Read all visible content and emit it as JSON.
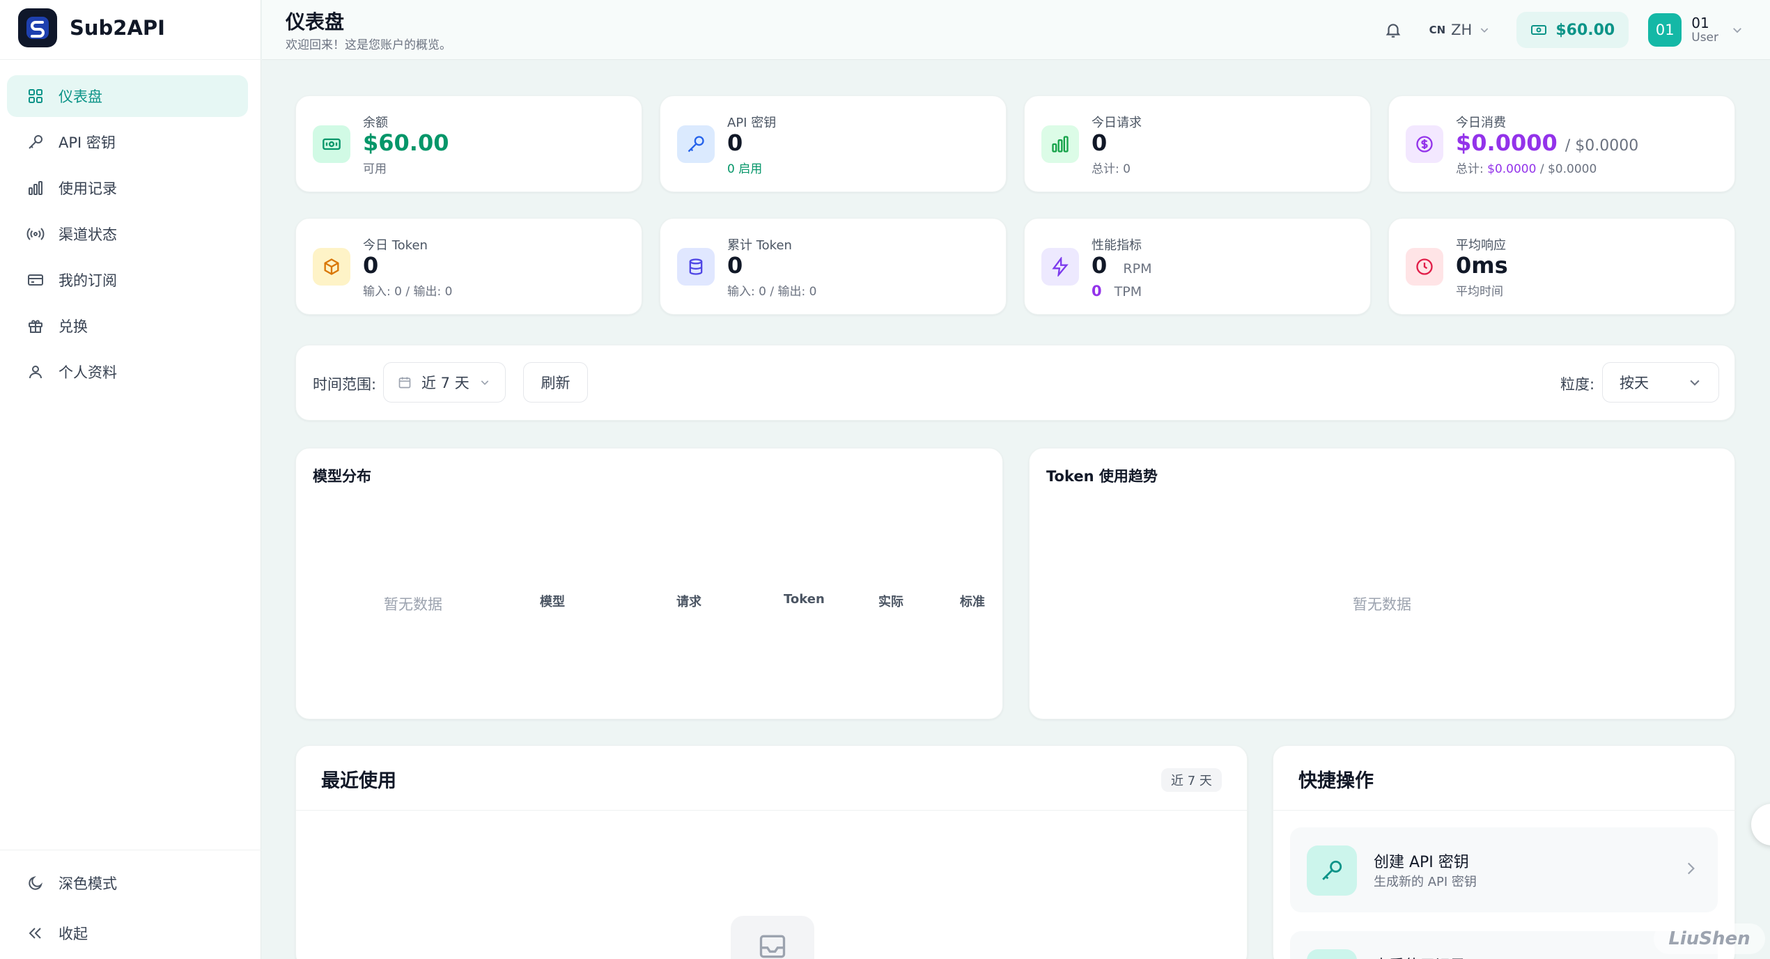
{
  "brand": {
    "name": "Sub2API"
  },
  "sidebar": {
    "items": [
      {
        "label": "仪表盘",
        "icon": "dashboard-grid-icon",
        "active": true
      },
      {
        "label": "API 密钥",
        "icon": "key-icon"
      },
      {
        "label": "使用记录",
        "icon": "bar-chart-icon"
      },
      {
        "label": "渠道状态",
        "icon": "signal-icon"
      },
      {
        "label": "我的订阅",
        "icon": "credit-card-icon"
      },
      {
        "label": "兑换",
        "icon": "gift-icon"
      },
      {
        "label": "个人资料",
        "icon": "user-icon"
      }
    ],
    "dark_mode_label": "深色模式",
    "collapse_label": "收起"
  },
  "header": {
    "title": "仪表盘",
    "subtitle": "欢迎回来！这是您账户的概览。",
    "lang_flag": "CN",
    "lang": "ZH",
    "balance": "$60.00",
    "avatar_text": "01",
    "username": "01",
    "role": "User"
  },
  "stats": {
    "balance": {
      "label": "余额",
      "value": "$60.00",
      "sub": "可用"
    },
    "api_keys": {
      "label": "API 密钥",
      "value": "0",
      "sub": "0 启用"
    },
    "today_requests": {
      "label": "今日请求",
      "value": "0",
      "sub": "总计: 0"
    },
    "today_cost": {
      "label": "今日消费",
      "value": "$0.0000",
      "value_secondary": "/ $0.0000",
      "sub_prefix": "总计: ",
      "sub_value": "$0.0000",
      "sub_secondary": " / $0.0000"
    },
    "today_tokens": {
      "label": "今日 Token",
      "value": "0",
      "sub": "输入: 0 / 输出: 0"
    },
    "total_tokens": {
      "label": "累计 Token",
      "value": "0",
      "sub": "输入: 0 / 输出: 0"
    },
    "performance": {
      "label": "性能指标",
      "rpm_value": "0",
      "rpm_unit": "RPM",
      "tpm_value": "0",
      "tpm_unit": "TPM"
    },
    "avg_response": {
      "label": "平均响应",
      "value": "0ms",
      "sub": "平均时间"
    }
  },
  "filters": {
    "range_label": "时间范围:",
    "range_value": "近 7 天",
    "refresh_label": "刷新",
    "granularity_label": "粒度:",
    "granularity_value": "按天"
  },
  "model_distribution": {
    "title": "模型分布",
    "empty": "暂无数据",
    "columns": [
      "模型",
      "请求",
      "Token",
      "实际",
      "标准"
    ]
  },
  "token_trend": {
    "title": "Token 使用趋势",
    "empty": "暂无数据"
  },
  "recent_usage": {
    "title": "最近使用",
    "badge": "近 7 天"
  },
  "quick_actions": {
    "title": "快捷操作",
    "items": [
      {
        "title": "创建 API 密钥",
        "subtitle": "生成新的 API 密钥"
      },
      {
        "title": "查看使用记录",
        "subtitle": ""
      }
    ]
  },
  "watermark": "LiuShen",
  "colors": {
    "accent": "#0d9488",
    "purple": "#9333ea",
    "success": "#059669"
  }
}
